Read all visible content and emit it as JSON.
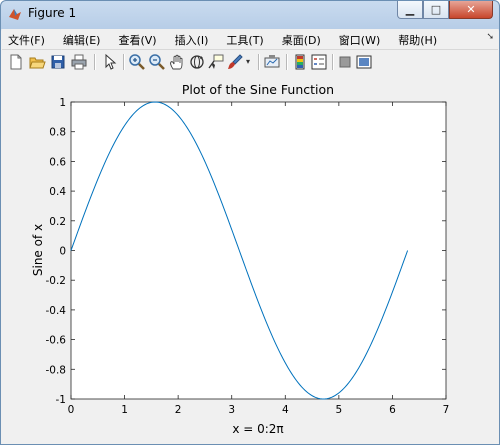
{
  "window": {
    "title": "Figure 1"
  },
  "menu": [
    "文件(F)",
    "编辑(E)",
    "查看(V)",
    "插入(I)",
    "工具(T)",
    "桌面(D)",
    "窗口(W)",
    "帮助(H)"
  ],
  "toolbar_icons": [
    "new-figure-icon",
    "open-file-icon",
    "save-icon",
    "print-icon",
    "pointer-icon",
    "zoom-in-icon",
    "zoom-out-icon",
    "pan-icon",
    "rotate-3d-icon",
    "data-cursor-icon",
    "brush-icon",
    "link-plot-icon",
    "colorbar-icon",
    "legend-icon",
    "hide-plot-tools-icon",
    "show-plot-tools-icon"
  ],
  "chart_data": {
    "type": "line",
    "title": "Plot of the Sine Function",
    "xlabel": "x = 0:2π",
    "ylabel": "Sine of x",
    "xlim": [
      0,
      7
    ],
    "ylim": [
      -1,
      1
    ],
    "xticks": [
      "0",
      "1",
      "2",
      "3",
      "4",
      "5",
      "6",
      "7"
    ],
    "yticks": [
      "-1",
      "-0.8",
      "-0.6",
      "-0.4",
      "-0.2",
      "0",
      "0.2",
      "0.4",
      "0.6",
      "0.8",
      "1"
    ],
    "series": [
      {
        "function": "sin(x)",
        "x_start": 0,
        "x_end": 6.2832,
        "color": "#0072bd"
      }
    ],
    "grid": false
  }
}
